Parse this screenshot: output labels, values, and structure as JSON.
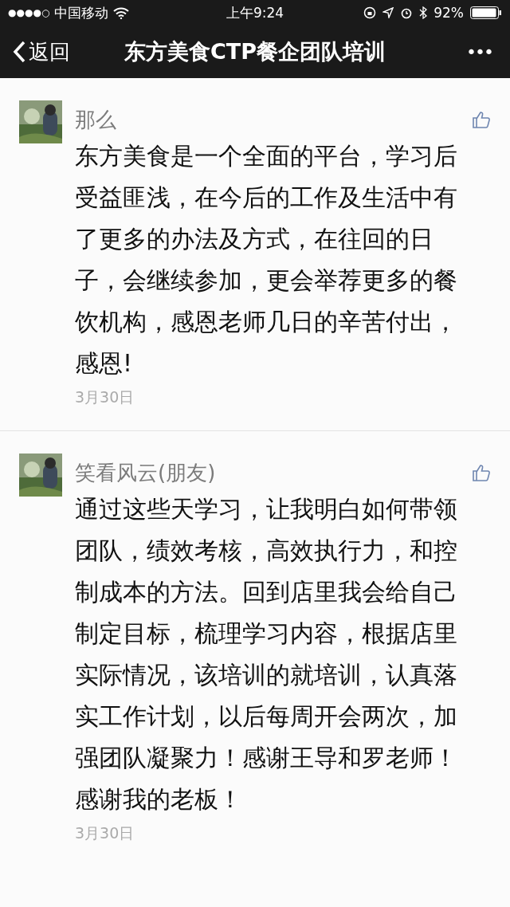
{
  "status_bar": {
    "signal": "●●●●○",
    "carrier": "中国移动",
    "time": "上午9:24",
    "battery": "92%"
  },
  "nav": {
    "back": "返回",
    "title": "东方美食CTP餐企团队培训",
    "more": "•••"
  },
  "comments": [
    {
      "author": "那么",
      "text": "东方美食是一个全面的平台，学习后受益匪浅，在今后的工作及生活中有了更多的办法及方式，在往回的日子，会继续参加，更会举荐更多的餐饮机构，感恩老师几日的辛苦付出，感恩!",
      "date": "3月30日"
    },
    {
      "author": "笑看风云(朋友)",
      "text": "通过这些天学习，让我明白如何带领团队，绩效考核，高效执行力，和控制成本的方法。回到店里我会给自己制定目标，梳理学习内容，根据店里实际情况，该培训的就培训，认真落实工作计划，以后每周开会两次，加强团队凝聚力！感谢王导和罗老师！感谢我的老板！",
      "date": "3月30日"
    }
  ]
}
